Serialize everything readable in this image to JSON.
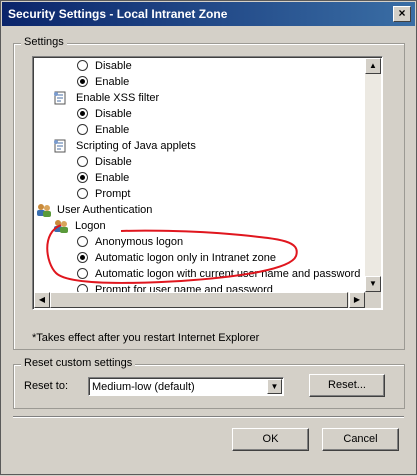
{
  "window": {
    "title": "Security Settings - Local Intranet Zone",
    "close_glyph": "×"
  },
  "settings": {
    "group_label": "Settings",
    "rows": [
      {
        "type": "radio",
        "label": "Disable",
        "checked": false
      },
      {
        "type": "radio",
        "label": "Enable",
        "checked": true
      },
      {
        "type": "setting",
        "label": "Enable XSS filter",
        "icon": "setting-icon"
      },
      {
        "type": "radio",
        "label": "Disable",
        "checked": true
      },
      {
        "type": "radio",
        "label": "Enable",
        "checked": false
      },
      {
        "type": "setting",
        "label": "Scripting of Java applets",
        "icon": "setting-icon"
      },
      {
        "type": "radio",
        "label": "Disable",
        "checked": false
      },
      {
        "type": "radio",
        "label": "Enable",
        "checked": true
      },
      {
        "type": "radio",
        "label": "Prompt",
        "checked": false
      },
      {
        "type": "category",
        "label": "User Authentication",
        "icon": "users-icon"
      },
      {
        "type": "subcategory",
        "label": "Logon",
        "icon": "users-icon"
      },
      {
        "type": "radio",
        "label": "Anonymous logon",
        "checked": false
      },
      {
        "type": "radio",
        "label": "Automatic logon only in Intranet zone",
        "checked": true
      },
      {
        "type": "radio",
        "label": "Automatic logon with current user name and password",
        "checked": false
      },
      {
        "type": "radio",
        "label": "Prompt for user name and password",
        "checked": false
      }
    ],
    "note": "*Takes effect after you restart Internet Explorer"
  },
  "reset": {
    "group_label": "Reset custom settings",
    "label": "Reset to:",
    "selected": "Medium-low (default)",
    "button": "Reset..."
  },
  "buttons": {
    "ok": "OK",
    "cancel": "Cancel"
  },
  "colors": {
    "annotation": "#e0161e",
    "titlebar": "#0a246a"
  }
}
